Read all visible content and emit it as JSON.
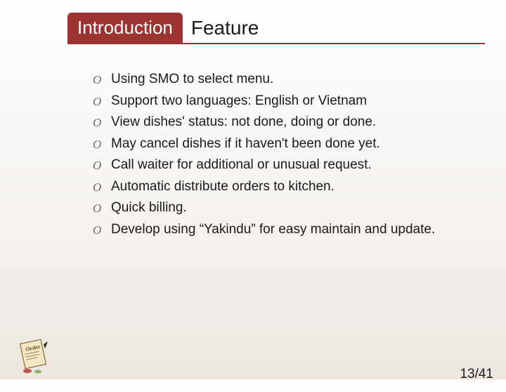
{
  "header": {
    "tab": "Introduction",
    "title": "Feature"
  },
  "features": [
    "Using SMO to select menu.",
    "Support two languages: English or Vietnam",
    "View dishes' status: not done, doing or done.",
    "May cancel dishes if it haven't been done yet.",
    "Call waiter for additional or unusual request.",
    "Automatic distribute orders to kitchen.",
    "Quick billing.",
    "Develop using “Yakindu” for easy maintain and update."
  ],
  "page": {
    "current": 13,
    "total": 41,
    "display": "13/41"
  },
  "icons": {
    "corner": "order-receipt-icon"
  }
}
